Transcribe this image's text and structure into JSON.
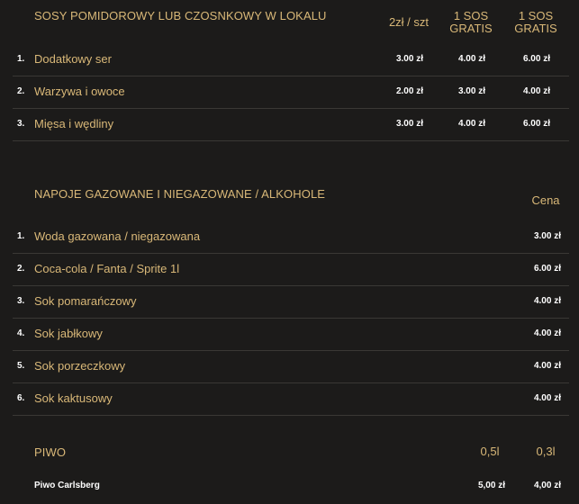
{
  "sauces": {
    "title": "SOSY POMIDOROWY LUB CZOSNKOWY W LOKALU",
    "columns": [
      "2zł / szt",
      "1 SOS\nGRATIS",
      "1 SOS\nGRATIS"
    ],
    "col1": "2zł / szt",
    "col2_line1": "1 SOS",
    "col2_line2": "GRATIS",
    "col3_line1": "1 SOS",
    "col3_line2": "GRATIS",
    "items": [
      {
        "num": "1.",
        "name": "Dodatkowy ser",
        "prices": [
          "3.00 zł",
          "4.00 zł",
          "6.00 zł"
        ]
      },
      {
        "num": "2.",
        "name": "Warzywa i owoce",
        "prices": [
          "2.00 zł",
          "3.00 zł",
          "4.00 zł"
        ]
      },
      {
        "num": "3.",
        "name": "Mięsa i wędliny",
        "prices": [
          "3.00 zł",
          "4.00 zł",
          "6.00 zł"
        ]
      }
    ]
  },
  "drinks": {
    "title": "NAPOJE GAZOWANE I NIEGAZOWANE / ALKOHOLE",
    "price_header": "Cena",
    "items": [
      {
        "num": "1.",
        "name": "Woda gazowana / niegazowana",
        "price": "3.00 zł"
      },
      {
        "num": "2.",
        "name": "Coca-cola / Fanta / Sprite 1l",
        "price": "6.00 zł"
      },
      {
        "num": "3.",
        "name": "Sok pomarańczowy",
        "price": "4.00 zł"
      },
      {
        "num": "4.",
        "name": "Sok jabłkowy",
        "price": "4.00 zł"
      },
      {
        "num": "5.",
        "name": "Sok porzeczkowy",
        "price": "4.00 zł"
      },
      {
        "num": "6.",
        "name": "Sok kaktusowy",
        "price": "4.00 zł"
      }
    ]
  },
  "beer": {
    "title": "PIWO",
    "col1": "0,5l",
    "col2": "0,3l",
    "items": [
      {
        "name": "Piwo Carlsberg",
        "prices": [
          "5,00 zł",
          "4,00 zł"
        ]
      }
    ]
  },
  "colors": {
    "background": "#1c1b1a",
    "gold": "#d9b878",
    "white": "#ffffff",
    "divider": "#3a3835"
  }
}
